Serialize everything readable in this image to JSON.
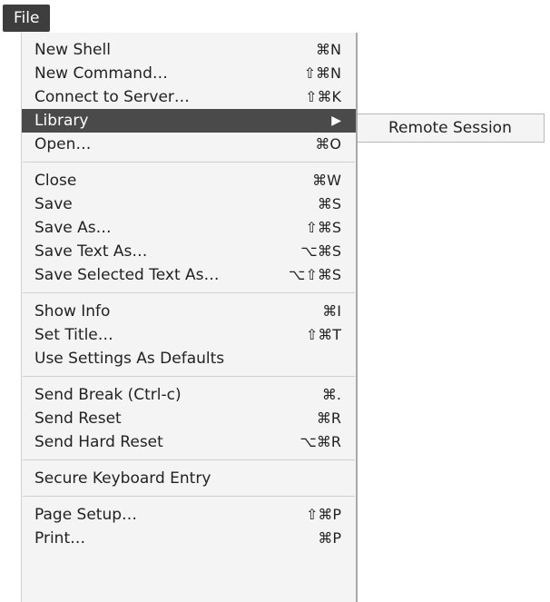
{
  "menubar": {
    "title": "File"
  },
  "menu": {
    "groups": [
      [
        {
          "label": "New Shell",
          "shortcut": "⌘N"
        },
        {
          "label": "New Command…",
          "shortcut": "⇧⌘N"
        },
        {
          "label": "Connect to Server…",
          "shortcut": "⇧⌘K"
        },
        {
          "label": "Library",
          "submenu_arrow": "▶"
        },
        {
          "label": "Open…",
          "shortcut": "⌘O"
        }
      ],
      [
        {
          "label": "Close",
          "shortcut": "⌘W"
        },
        {
          "label": "Save",
          "shortcut": "⌘S"
        },
        {
          "label": "Save As…",
          "shortcut": "⇧⌘S"
        },
        {
          "label": "Save Text As…",
          "shortcut": "⌥⌘S"
        },
        {
          "label": "Save Selected Text As…",
          "shortcut": "⌥⇧⌘S"
        }
      ],
      [
        {
          "label": "Show Info",
          "shortcut": "⌘I"
        },
        {
          "label": "Set Title…",
          "shortcut": "⇧⌘T"
        },
        {
          "label": "Use Settings As Defaults"
        }
      ],
      [
        {
          "label": "Send Break (Ctrl-c)",
          "shortcut": "⌘."
        },
        {
          "label": "Send Reset",
          "shortcut": "⌘R"
        },
        {
          "label": "Send Hard Reset",
          "shortcut": "⌥⌘R"
        }
      ],
      [
        {
          "label": "Secure Keyboard Entry"
        }
      ],
      [
        {
          "label": "Page Setup…",
          "shortcut": "⇧⌘P"
        },
        {
          "label": "Print…",
          "shortcut": "⌘P"
        }
      ]
    ]
  },
  "submenu": {
    "items": [
      {
        "label": "Remote Session"
      }
    ]
  },
  "colors": {
    "highlight": "#4a4a4a",
    "menu_background": "#f4f4f4",
    "text": "#222222"
  }
}
